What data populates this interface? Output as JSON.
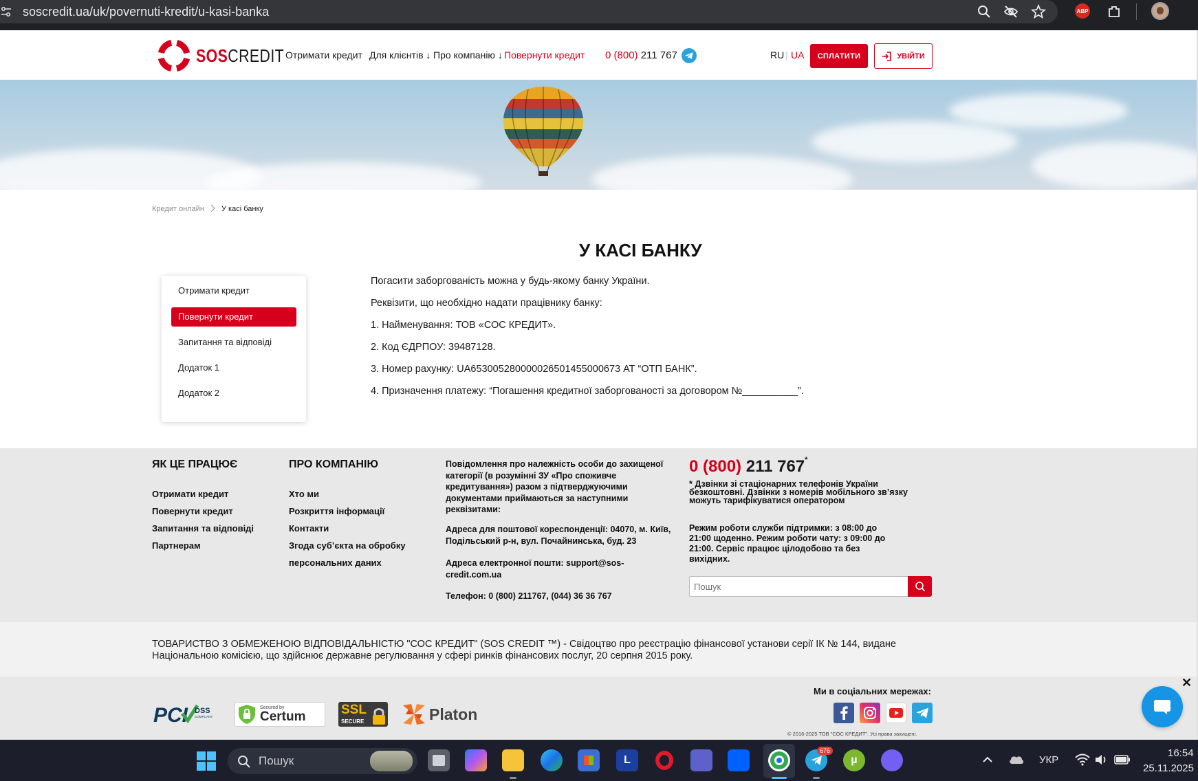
{
  "browser": {
    "url": "soscredit.ua/uk/povernuti-kredit/u-kasi-banka",
    "extension_badge": "ABP"
  },
  "header": {
    "logo_prefix": "SOS",
    "logo_suffix": "CREDIT",
    "nav": [
      {
        "label": "Отримати кредит"
      },
      {
        "label": "Для клієнтів ↓"
      },
      {
        "label": "Про компанію ↓"
      },
      {
        "label": "Повернути кредит"
      }
    ],
    "phone_prefix": "0 (800)",
    "phone_number": " 211 767",
    "lang_ru": "RU",
    "lang_sep": "|",
    "lang_ua": "UA",
    "pay_label": "СПЛАТИТИ",
    "login_label": "УВІЙТИ"
  },
  "breadcrumb": {
    "home": "Кредит онлайн",
    "current": "У касі банку"
  },
  "main": {
    "title": "У КАСІ БАНКУ",
    "side_menu": [
      {
        "label": "Отримати кредит"
      },
      {
        "label": "Повернути кредит"
      },
      {
        "label": "Запитання та відповіді"
      },
      {
        "label": "Додаток 1"
      },
      {
        "label": "Додаток 2"
      }
    ],
    "paragraphs": [
      "Погасити заборгованість можна у будь-якому банку України.",
      "Реквізити, що необхідно надати працівнику банку:",
      "1. Найменування: ТОВ «СОС КРЕДИТ».",
      "2. Код ЄДРПОУ: 39487128.",
      "3. Номер рахунку: UA653005280000026501455000673 АТ “ОТП БАНК”.",
      "4. Призначення платежу: “Погашення кредитної заборгованості за договором №__________”."
    ]
  },
  "footer": {
    "col1_title": "ЯК ЦЕ ПРАЦЮЄ",
    "col1_links": [
      "Отримати кредит",
      "Повернути кредит",
      "Запитання та відповіді",
      "Партнерам"
    ],
    "col2_title": "ПРО КОМПАНІЮ",
    "col2_links": [
      "Хто ми",
      "Розкриття інформації",
      "Контакти",
      "Згода суб’єкта на обробку",
      "персональних даних"
    ],
    "notice": "Повідомлення про належність особи до захищеної категорії (в розумінні ЗУ «Про споживче кредитування») разом з підтверджуючими документами приймаються за наступними реквізитами:",
    "postal": "Адреса для поштової кореспонденції: 04070, м. Київ, Подільський р-н, вул. Почайнинська, буд. 23",
    "email": "Адреса електронної пошти: support@sos-credit.com.ua",
    "phones": "Телефон: 0 (800) 211767, (044) 36 36 767",
    "phone_prefix": "0 (800)",
    "phone_number": " 211 767",
    "phone_star": "*",
    "phone_note": "* Дзвінки зі стаціонарних телефонів України безкоштовні.  Дзвінки з номерів мобільного зв’язку можуть тарифікуватися оператором",
    "hours": "Режим роботи служби підтримки: з 08:00 до 21:00 щоденно. Режим роботи чату: з 09:00 до 21:00. Сервіс працює цілодобово та без вихідних.",
    "search_placeholder": "Пошук",
    "legal": "ТОВАРИСТВО З ОБМЕЖЕНОЮ ВІДПОВІДАЛЬНІСТЮ \"СОС КРЕДИТ\" (SOS CREDIT ™) - Свідоцтво про реєстрацію фінансової установи серії ІК № 144, видане Національною комісією, що здійснює державне регулювання у сфері ринків фінансових послуг, 20 серпня 2015 року.",
    "social_title": "Ми в соціальних мережах:",
    "copyright": "© 2016-2025 ТОВ \"СОС КРЕДИТ\". Усі права захищені.",
    "badges": {
      "pci": "PCI",
      "dss": "DSS",
      "compliant": "COMPLIANT",
      "certum_top": "Secured by",
      "certum": "Certum",
      "ssl": "SSL",
      "secure": "SECURE",
      "platon": "Platon"
    }
  },
  "chat": {
    "close_label": "✕"
  },
  "taskbar": {
    "search_label": "Пошук",
    "telegram_badge": "676",
    "language": "УКР",
    "time": "16:54",
    "date": "25.11.2025"
  },
  "colors": {
    "brand_red": "#d6001c",
    "footer_bg": "#e8e8e8",
    "chat_blue": "#1694e6"
  }
}
